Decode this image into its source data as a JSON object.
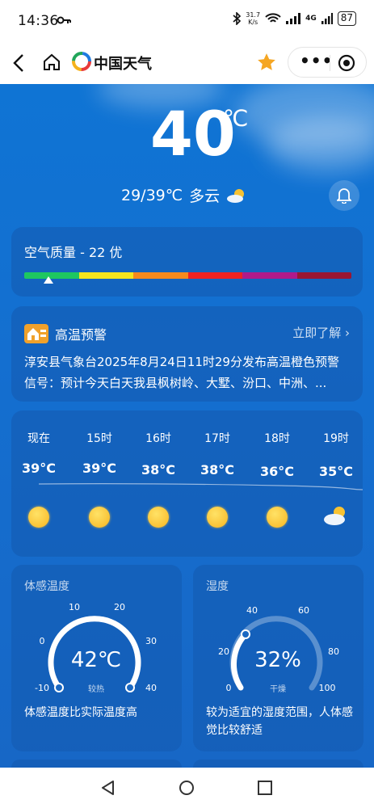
{
  "status_bar": {
    "time": "14:36",
    "speed_top": "31.7",
    "speed_bottom": "K/s",
    "network": "4G",
    "battery": "87"
  },
  "nav": {
    "brand": "中国天气"
  },
  "current": {
    "temperature": "40",
    "unit": "℃",
    "range": "29/39℃",
    "condition": "多云"
  },
  "air_quality": {
    "label": "空气质量 - 22 优",
    "colors": [
      "#1ec760",
      "#f5e51e",
      "#f58a1e",
      "#ee2222",
      "#b01a8a",
      "#9a1633"
    ]
  },
  "warning": {
    "title": "高温预警",
    "more": "立即了解",
    "line1": "淳安县气象台2025年8月24日11时29分发布高温橙色预警",
    "line2": "信号：预计今天白天我县枫树岭、大墅、汾口、中洲、..."
  },
  "hourly": [
    {
      "hour": "现在",
      "temp": "39°C",
      "icon": "sun-icon"
    },
    {
      "hour": "15时",
      "temp": "39°C",
      "icon": "sun-icon"
    },
    {
      "hour": "16时",
      "temp": "38°C",
      "icon": "sun-icon"
    },
    {
      "hour": "17时",
      "temp": "38°C",
      "icon": "sun-icon"
    },
    {
      "hour": "18时",
      "temp": "36°C",
      "icon": "sun-icon"
    },
    {
      "hour": "19时",
      "temp": "35°C",
      "icon": "partly-cloudy-icon"
    }
  ],
  "feels_like": {
    "title": "体感温度",
    "value": "42℃",
    "level": "较热",
    "ticks": [
      "-10",
      "0",
      "10",
      "20",
      "30",
      "40"
    ],
    "description": "体感温度比实际温度高"
  },
  "humidity": {
    "title": "湿度",
    "value": "32%",
    "level": "干燥",
    "ticks": [
      "0",
      "20",
      "40",
      "60",
      "80",
      "100"
    ],
    "description": "较为适宜的湿度范围，人体感觉比较舒适"
  }
}
